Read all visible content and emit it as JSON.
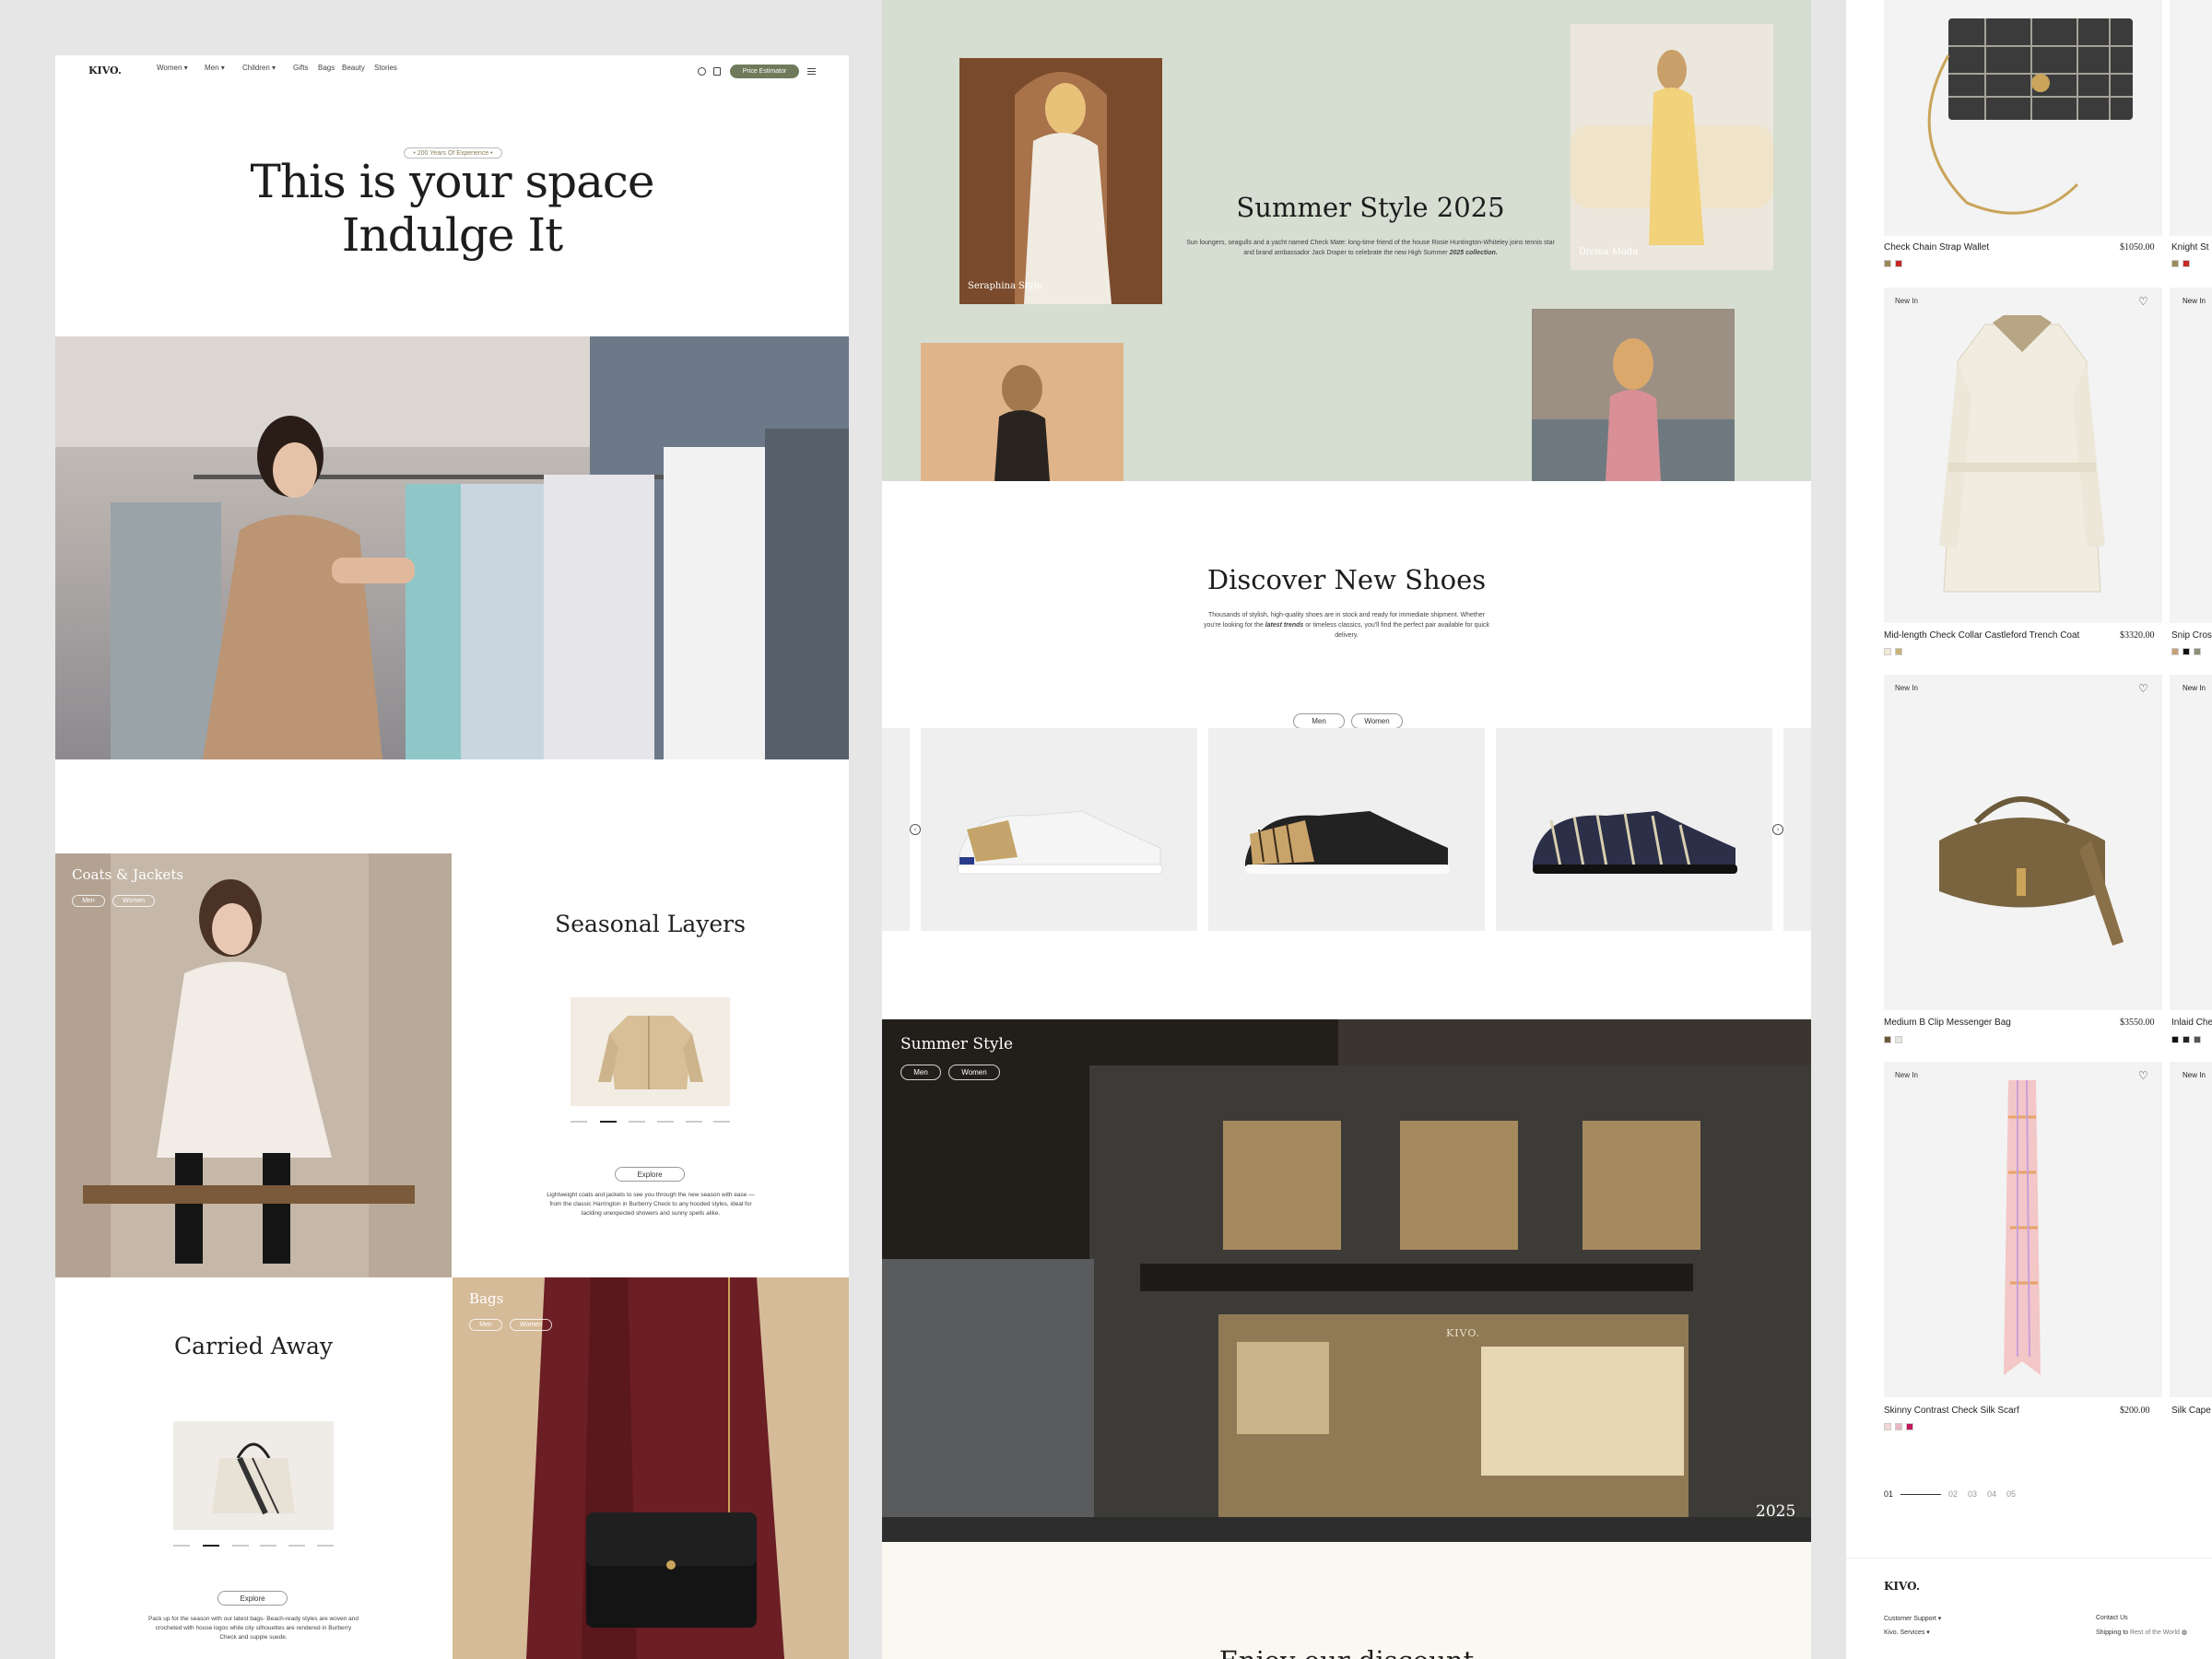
{
  "brand": "KIVO.",
  "nav": {
    "items": [
      "Women",
      "Men",
      "Children",
      "Gifts",
      "Bags",
      "Beauty",
      "Stories"
    ],
    "cta": "Price Estimator"
  },
  "hero": {
    "badge": "• 200 Years Of Experience •",
    "title_line1": "This is your space",
    "title_line2": "Indulge It"
  },
  "coats": {
    "label": "Coats & Jackets",
    "men": "Men",
    "women": "Women"
  },
  "seasonal": {
    "title": "Seasonal Layers",
    "explore": "Explore",
    "desc": "Lightweight coats and jackets to see you through the new season with ease — from the classic Harrington in Burberry Check to any hooded styles, ideal for tackling unexpected showers and sunny spells alike."
  },
  "carried": {
    "title": "Carried Away",
    "explore": "Explore",
    "desc": "Pack up for the season with our latest bags- Beach-ready styles are woven and crocheted with house logos while city silhouettes are rendered in Burberry Check and supple suede."
  },
  "bags": {
    "label": "Bags",
    "men": "Men",
    "women": "Women"
  },
  "summer": {
    "title": "Summer Style 2025",
    "desc_pre": "Sun loungers, seagulls and a yacht named Check Mate: long-time friend of the house Rosie Huntington-Whiteley joins tennis star and brand ambassador Jack Draper to celebrate the new High Summer",
    "desc_em": "2025 collection.",
    "caption1": "Seraphina Style",
    "caption2": "Divina Moda"
  },
  "shoes": {
    "title": "Discover New Shoes",
    "desc_pre": "Thousands of stylish, high-quality shoes are in stock and ready for immediate shipment. Whether you're looking for the",
    "desc_em": "latest trends",
    "desc_post": "or timeless classics, you'll find the perfect pair available for quick delivery.",
    "men": "Men",
    "women": "Women"
  },
  "store": {
    "title": "Summer Style",
    "men": "Men",
    "women": "Women",
    "year": "2025",
    "sign": "KIVO."
  },
  "bottom_heading": "Enjoy our discount",
  "products": [
    {
      "name": "Check Chain Strap Wallet",
      "price": "$1050.00",
      "swatches": [
        "#9a8a5a",
        "#c62828"
      ]
    },
    {
      "badge": "New In",
      "name": "Mid-length Check Collar Castleford Trench Coat",
      "price": "$3320.00",
      "swatches": [
        "#f1ead8",
        "#c9b37a"
      ]
    },
    {
      "badge": "New In",
      "name": "Medium B Clip Messenger Bag",
      "price": "$3550.00",
      "swatches": [
        "#6b5a3a",
        "#e8e6e0"
      ]
    },
    {
      "badge": "New In",
      "name": "Skinny Contrast Check Silk Scarf",
      "price": "$200.00",
      "swatches": [
        "#f2d6d6",
        "#e8b7c4",
        "#c2185b"
      ]
    }
  ],
  "products_peek": [
    {
      "name": "Knight St",
      "badge": ""
    },
    {
      "name": "Snip Cros",
      "badge": "New In"
    },
    {
      "name": "Inlaid Che",
      "badge": "New In"
    },
    {
      "name": "Silk Cape",
      "badge": "New In"
    }
  ],
  "pagination": {
    "current": "01",
    "pages": [
      "02",
      "03",
      "04",
      "05"
    ]
  },
  "footer": {
    "brand": "KIVO.",
    "customer_support": "Customer Support",
    "services": "Kivo. Services",
    "contact": "Contact Us",
    "shipping_to": "Shipping to",
    "region": "Rest of the World"
  },
  "colors": {
    "accent": "#6f7a5a",
    "sage": "#d6ddd1",
    "dark": "#2a2722"
  }
}
